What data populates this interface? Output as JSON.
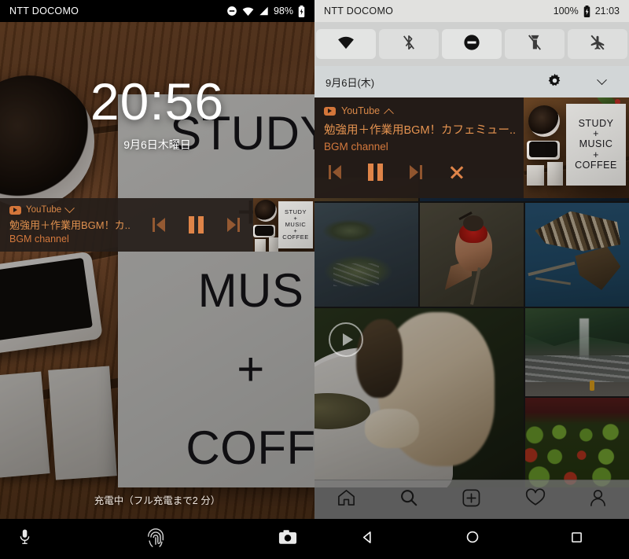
{
  "left_panel": {
    "status_bar": {
      "carrier": "NTT DOCOMO",
      "battery_percent": "98%",
      "icons": [
        "do-not-disturb-icon",
        "wifi-icon",
        "signal-icon",
        "battery-charging-icon"
      ]
    },
    "lock_screen": {
      "time": "20:56",
      "date": "9月6日木曜日",
      "charging_status": "充電中（フル充電まで2 分）"
    },
    "notification": {
      "app_name": "YouTube",
      "expand_state": "chevron-down-icon",
      "title": "勉強用＋作業用BGM！カ..",
      "subtitle": "BGM channel",
      "controls": [
        "previous-icon",
        "pause-icon",
        "next-icon"
      ],
      "album_art_text": [
        "STUDY",
        "+",
        "MUSIC",
        "+",
        "COFFEE"
      ]
    },
    "bottom_bar": {
      "items": [
        "mic-icon",
        "fingerprint-icon",
        "camera-icon"
      ]
    }
  },
  "right_panel": {
    "status_bar": {
      "carrier": "NTT DOCOMO",
      "battery_percent": "100%",
      "clock": "21:03",
      "icons": [
        "battery-charging-icon"
      ]
    },
    "quick_settings": {
      "tiles": [
        {
          "name": "wifi-icon",
          "state": "on"
        },
        {
          "name": "bluetooth-off-icon",
          "state": "off"
        },
        {
          "name": "do-not-disturb-icon",
          "state": "on"
        },
        {
          "name": "flashlight-off-icon",
          "state": "off"
        },
        {
          "name": "airplane-mode-off-icon",
          "state": "off"
        }
      ],
      "date": "9月6日(木)",
      "settings_icon": "gear-icon",
      "expand_icon": "chevron-down-icon"
    },
    "notification": {
      "app_name": "YouTube",
      "expand_state": "chevron-up-icon",
      "title": "勉強用＋作業用BGM！カフェミュー..",
      "subtitle": "BGM channel",
      "controls": [
        "previous-icon",
        "pause-icon",
        "next-icon",
        "close-icon"
      ],
      "album_art_text": [
        "STUDY",
        "+",
        "MUSIC",
        "+",
        "COFFEE"
      ]
    },
    "instagram": {
      "grid_tiles": [
        "lake-islands-photo",
        "hummingbird-photo",
        "eagle-photo",
        "dog-video",
        "waterfall-photo",
        "lettuce-pots-photo"
      ],
      "video_badge": "play-icon",
      "tab_bar": [
        "home-icon",
        "search-icon",
        "add-post-icon",
        "activity-heart-icon",
        "profile-icon"
      ]
    },
    "nav_bar": [
      "back-icon",
      "home-icon",
      "recents-icon"
    ]
  },
  "colors": {
    "accent_orange": "#d4793d",
    "notification_bg": "#241c18",
    "shade_bg": "#e4e5e4",
    "nav_bg": "#000000"
  }
}
